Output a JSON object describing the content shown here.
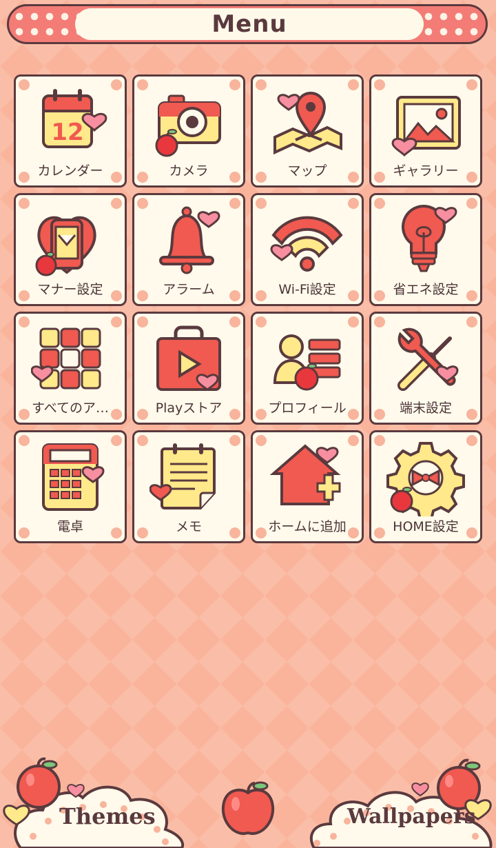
{
  "header": {
    "title": "Menu"
  },
  "tiles": [
    {
      "label": "カレンダー",
      "icon": "calendar-icon",
      "calendar_day": "12"
    },
    {
      "label": "カメラ",
      "icon": "camera-icon"
    },
    {
      "label": "マップ",
      "icon": "map-icon"
    },
    {
      "label": "ギャラリー",
      "icon": "gallery-icon"
    },
    {
      "label": "マナー設定",
      "icon": "manner-mode-icon"
    },
    {
      "label": "アラーム",
      "icon": "bell-icon"
    },
    {
      "label": "Wi-Fi設定",
      "icon": "wifi-icon"
    },
    {
      "label": "省エネ設定",
      "icon": "lightbulb-icon"
    },
    {
      "label": "すべてのア…",
      "icon": "all-apps-icon"
    },
    {
      "label": "Playストア",
      "icon": "play-store-icon"
    },
    {
      "label": "プロフィール",
      "icon": "profile-icon"
    },
    {
      "label": "端末設定",
      "icon": "tools-icon"
    },
    {
      "label": "電卓",
      "icon": "calculator-icon"
    },
    {
      "label": "メモ",
      "icon": "memo-icon"
    },
    {
      "label": "ホームに追加",
      "icon": "add-home-icon"
    },
    {
      "label": "HOME設定",
      "icon": "home-settings-icon"
    }
  ],
  "bottom": {
    "themes_label": "Themes",
    "wallpapers_label": "Wallpapers"
  },
  "colors": {
    "background": "#f9b49b",
    "tile": "#fffaeb",
    "outline": "#5a3a3e",
    "accent_red": "#f05a50",
    "accent_yellow": "#ffe98a",
    "heart_pink": "#f78fa0"
  }
}
